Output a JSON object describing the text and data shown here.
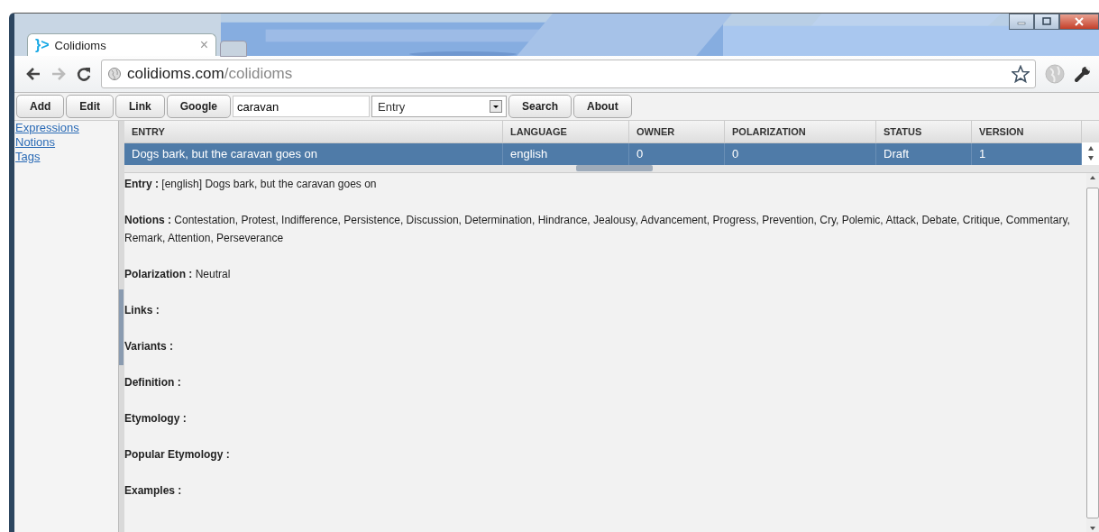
{
  "browser": {
    "tab": {
      "logo": "}>",
      "title": "Colidioms",
      "close": "×"
    },
    "url": {
      "host": "colidioms.com",
      "path": "/colidioms"
    }
  },
  "toolbar": {
    "buttons": [
      "Add",
      "Edit",
      "Link",
      "Google"
    ],
    "search": {
      "value": "caravan"
    },
    "select": {
      "value": "Entry"
    },
    "buttons_after": [
      "Search",
      "About"
    ]
  },
  "sidebar": {
    "links": [
      "Expressions",
      "Notions",
      "Tags"
    ]
  },
  "table": {
    "columns": [
      "ENTRY",
      "LANGUAGE",
      "OWNER",
      "POLARIZATION",
      "STATUS",
      "VERSION"
    ],
    "rows": [
      {
        "cells": [
          "Dogs bark, but the caravan goes on",
          "english",
          "0",
          "0",
          "Draft",
          "1"
        ],
        "selected": true
      }
    ]
  },
  "details": [
    {
      "text": "**Entry :** [english] Dogs bark, but the caravan goes on"
    },
    {
      "text": "**Notions :** Contestation, Protest, Indifference, Persistence, Discussion, Determination, Hindrance, Jealousy, Advancement, Progress, Prevention, Cry, Polemic, Attack, Debate, Critique, Commentary, Remark, Attention, Perseverance"
    },
    {
      "text": "**Polarization :** Neutral"
    },
    {
      "text": "**Links :**"
    },
    {
      "text": "**Variants :**"
    },
    {
      "text": "**Definition :**"
    },
    {
      "text": "**Etymology :**"
    },
    {
      "text": "**Popular Etymology :**"
    },
    {
      "text": "**Examples :**"
    }
  ]
}
